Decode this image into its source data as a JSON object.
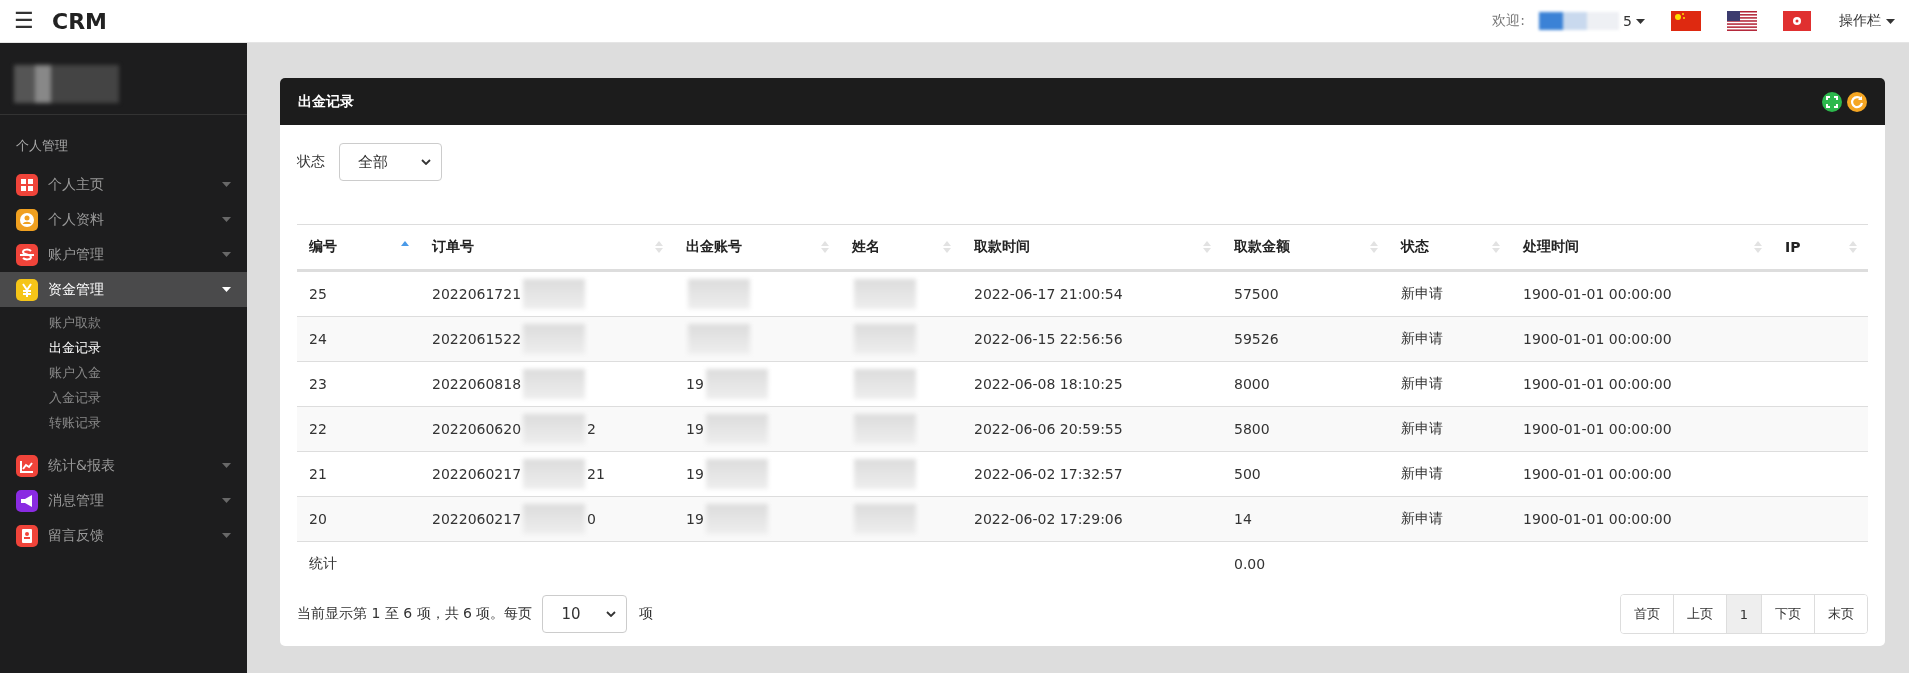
{
  "header": {
    "menu_label": "☰",
    "brand": "CRM",
    "welcome": "欢迎:",
    "user_visible": "5",
    "user_blurred": true,
    "languages": [
      {
        "kind": "cn"
      },
      {
        "kind": "us"
      },
      {
        "kind": "hk"
      }
    ],
    "toolbar_menu": "操作栏"
  },
  "sidebar": {
    "profile_blurred": true,
    "section": "个人管理",
    "items": [
      {
        "label": "个人主页",
        "kind": "grid",
        "color": "#f0443a",
        "expanded": false,
        "selected": false
      },
      {
        "label": "个人资料",
        "kind": "user",
        "color": "#f0a020",
        "expanded": false,
        "selected": false
      },
      {
        "label": "账户管理",
        "kind": "dollar",
        "color": "#f0443a",
        "expanded": false,
        "selected": false
      },
      {
        "label": "资金管理",
        "kind": "yen",
        "color": "#f5c518",
        "expanded": true,
        "selected": true,
        "children": [
          {
            "label": "账户取款",
            "selected": false
          },
          {
            "label": "出金记录",
            "selected": true
          },
          {
            "label": "账户入金",
            "selected": false
          },
          {
            "label": "入金记录",
            "selected": false
          },
          {
            "label": "转账记录",
            "selected": false
          }
        ]
      },
      {
        "label": "统计&报表",
        "kind": "chart",
        "color": "#f0443a",
        "expanded": false,
        "selected": false
      },
      {
        "label": "消息管理",
        "kind": "megaphone",
        "color": "#8a2be2",
        "expanded": false,
        "selected": false
      },
      {
        "label": "留言反馈",
        "kind": "contact",
        "color": "#f0443a",
        "expanded": false,
        "selected": false
      }
    ]
  },
  "panel": {
    "title": "出金记录",
    "filter": {
      "label": "状态",
      "value": "全部"
    },
    "table": {
      "columns": [
        {
          "label": "编号",
          "sorted_ascending": true
        },
        {
          "label": "订单号",
          "sorted_ascending": false
        },
        {
          "label": "出金账号",
          "sorted_ascending": false
        },
        {
          "label": "姓名",
          "sorted_ascending": false
        },
        {
          "label": "取款时间",
          "sorted_ascending": false
        },
        {
          "label": "取款金额",
          "sorted_ascending": false
        },
        {
          "label": "状态",
          "sorted_ascending": false
        },
        {
          "label": "处理时间",
          "sorted_ascending": false
        },
        {
          "label": "IP",
          "sorted_ascending": false
        }
      ],
      "rows": [
        {
          "id": "25",
          "order": {
            "start": "2022061721",
            "blurred": true
          },
          "account": {
            "blurred": true
          },
          "name": {
            "blurred": true
          },
          "time": "2022-06-17 21:00:54",
          "amount": "57500",
          "status": "新申请",
          "processed": "1900-01-01 00:00:00"
        },
        {
          "id": "24",
          "order": {
            "start": "2022061522",
            "blurred": true
          },
          "account": {
            "blurred": true
          },
          "name": {
            "blurred": true
          },
          "time": "2022-06-15 22:56:56",
          "amount": "59526",
          "status": "新申请",
          "processed": "1900-01-01 00:00:00"
        },
        {
          "id": "23",
          "order": {
            "start": "2022060818",
            "blurred": true
          },
          "account": {
            "start": "19",
            "blurred": true
          },
          "name": {
            "blurred": true
          },
          "time": "2022-06-08 18:10:25",
          "amount": "8000",
          "status": "新申请",
          "processed": "1900-01-01 00:00:00"
        },
        {
          "id": "22",
          "order": {
            "start": "2022060620",
            "end": "2",
            "blurred": true
          },
          "account": {
            "start": "19",
            "blurred": true
          },
          "name": {
            "blurred": true
          },
          "time": "2022-06-06 20:59:55",
          "amount": "5800",
          "status": "新申请",
          "processed": "1900-01-01 00:00:00"
        },
        {
          "id": "21",
          "order": {
            "start": "2022060217",
            "end": "21",
            "blurred": true
          },
          "account": {
            "start": "19",
            "blurred": true
          },
          "name": {
            "blurred": true
          },
          "time": "2022-06-02 17:32:57",
          "amount": "500",
          "status": "新申请",
          "processed": "1900-01-01 00:00:00"
        },
        {
          "id": "20",
          "order": {
            "start": "2022060217",
            "end": "0",
            "blurred": true
          },
          "account": {
            "start": "19",
            "blurred": true
          },
          "name": {
            "blurred": true
          },
          "time": "2022-06-02 17:29:06",
          "amount": "14",
          "status": "新申请",
          "processed": "1900-01-01 00:00:00"
        }
      ],
      "totals": {
        "label": "统计",
        "amount": "0.00"
      }
    },
    "footer": {
      "info": "当前显示第 1 至 6 项，共 6 项。每页",
      "page_size": "10",
      "unit": "项"
    },
    "pagination": [
      {
        "label": "首页",
        "selected": false
      },
      {
        "label": "上页",
        "selected": false
      },
      {
        "label": "1",
        "selected": true
      },
      {
        "label": "下页",
        "selected": false
      },
      {
        "label": "末页",
        "selected": false
      }
    ]
  }
}
